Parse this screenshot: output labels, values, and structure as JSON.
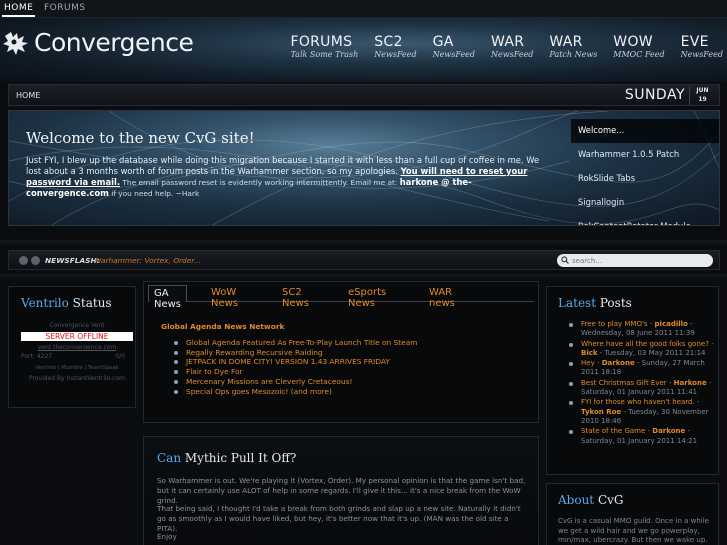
{
  "topnav": {
    "home": "HOME",
    "forums": "FORUMS"
  },
  "logo": {
    "text": "Convergence"
  },
  "nav": [
    {
      "title": "FORUMS",
      "sub": "Talk Some Trash"
    },
    {
      "title": "SC2",
      "sub": "NewsFeed"
    },
    {
      "title": "GA",
      "sub": "NewsFeed"
    },
    {
      "title": "WAR",
      "sub": "NewsFeed"
    },
    {
      "title": "WAR",
      "sub": "Patch News"
    },
    {
      "title": "WOW",
      "sub": "MMOC Feed"
    },
    {
      "title": "EVE",
      "sub": "NewsFeed"
    }
  ],
  "crumb": {
    "label": "HOME",
    "day": "SUNDAY",
    "month": "JUN",
    "date": "19"
  },
  "hero": {
    "title": "Welcome to the new CvG site!",
    "text1": "Just FYI, I blew up the database while doing this migration because I started it with less than a full cup of coffee in me. We lost about a 3 months worth of forum posts in the Warhammer section, so my apologies. ",
    "bold": "You will need to reset your password via email.",
    "note": " The email password reset is evidently working intermittently. Email me at: ",
    "mail": "harkone @ the-convergence.com",
    "end": " if you need help. ~Hark",
    "menu": [
      "Welcome...",
      "Warhammer 1.0.5 Patch",
      "RokSlide Tabs",
      "Signallogin",
      "RokContentRotator Module"
    ]
  },
  "flash": {
    "label": "NEWSFLASH:",
    "text": "Warhammer: Vortex, Order...",
    "search_placeholder": "search..."
  },
  "ventrilo": {
    "title_hl": "Ventrilo",
    "title": " Status",
    "server": "Convergence Vent",
    "status": "SERVER OFFLINE",
    "host": "vent.theconvergence.com",
    "port_label": "Port: 4227",
    "port_val": "0/0",
    "links": "Ventrilo | Mumble | TeamSpeak",
    "provider": "Provided By InstantVentrilo.com"
  },
  "tabs": {
    "items": [
      "GA News",
      "WoW News",
      "SC2 News",
      "eSports News",
      "WAR news"
    ],
    "heading": "Global Agenda News Network",
    "list": [
      "Global Agenda Featured As Free-To-Play Launch Title on Steam",
      "Regally Rewarding Recursive Raiding",
      "JETPACK IN DOME CITY! VERSION 1.43 ARRIVES FRIDAY",
      "Flair to Dye For",
      "Mercenary Missions are Cleverly Cretaceous!",
      "Special Ops goes Mesozoic! (and more)"
    ]
  },
  "article": {
    "title_hl": "Can",
    "title": " Mythic Pull It Off?",
    "p1": "So Warhammer is out. We're playing it (Vortex, Order). My personal opinion is that the game isn't bad, but it can certainly use ALOT of help in some regards. I'll give it this... it's a nice break from the WoW grind.",
    "p2": "That being said, I thought I'd take a break from both grinds and slap up a new site. Naturally it didn't go as smoothly as I would have liked, but hey, it's better now that it's up. (MAN was the old site a PITA).",
    "p3": "Enjoy"
  },
  "latest": {
    "title_hl": "Latest",
    "title": " Posts",
    "posts": [
      {
        "title": "Free to play MMO's",
        "author": "picadillo",
        "meta": " - Wednesday, 08 June 2011 11:39"
      },
      {
        "title": "Where have all the good folks gone?",
        "author": "Bick",
        "meta": " - Tuesday, 03 May 2011 21:14"
      },
      {
        "title": "Hey",
        "author": "Darkone",
        "meta": " - Sunday, 27 March 2011 18:18"
      },
      {
        "title": "Best Christmas Gift Ever",
        "author": "Harkone",
        "meta": " - Saturday, 01 January 2011 11:41"
      },
      {
        "title": "FYI for those who haven't heard.",
        "author": "Tykon Roe",
        "meta": " - Tuesday, 30 November 2010 18:46"
      },
      {
        "title": "State of the Game",
        "author": "Darkone",
        "meta": " - Saturday, 01 January 2011 14:21"
      }
    ]
  },
  "about": {
    "title_hl": "About",
    "title": " CvG",
    "text": "CvG is a casual MMO guild. Once in a while we get a wild hair and we go powerplay, min/max, ubercrazy. But then we wake up."
  }
}
